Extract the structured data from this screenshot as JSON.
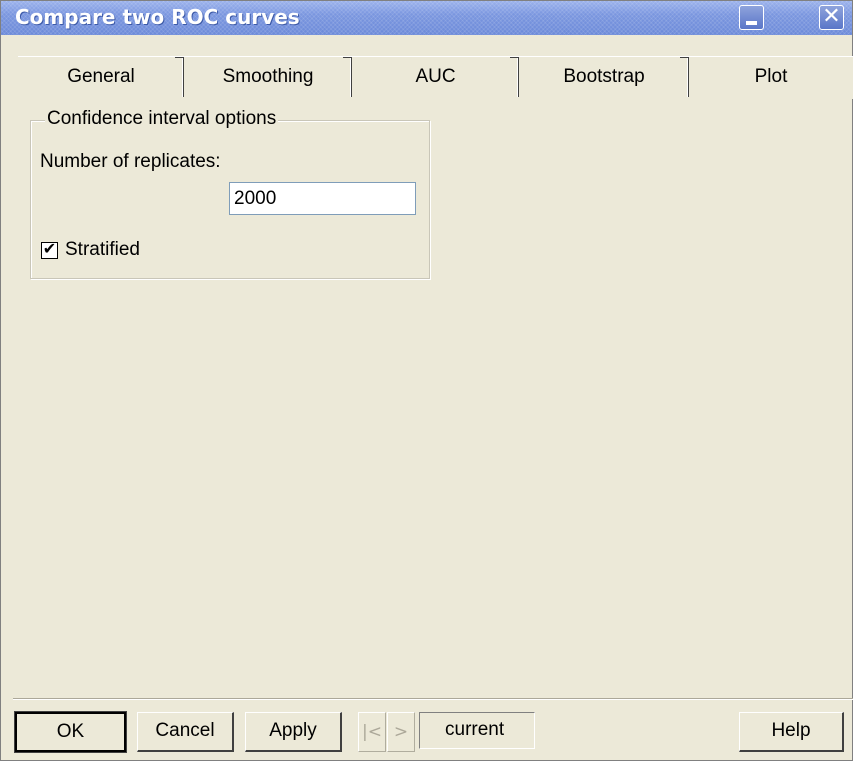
{
  "window": {
    "title": "Compare two ROC curves",
    "minimize_icon": "minimize-icon",
    "close_icon": "close-icon",
    "close_glyph": "✕"
  },
  "tabs": [
    {
      "label": "General"
    },
    {
      "label": "Smoothing"
    },
    {
      "label": "AUC"
    },
    {
      "label": "Bootstrap"
    },
    {
      "label": "Plot"
    }
  ],
  "confidence_group": {
    "legend": "Confidence interval options",
    "replicates_label": "Number of replicates:",
    "replicates_value": "2000",
    "stratified_label": "Stratified",
    "stratified_checked": true,
    "check_glyph": "✔"
  },
  "footer": {
    "ok_label": "OK",
    "cancel_label": "Cancel",
    "apply_label": "Apply",
    "prev_glyph": "|<",
    "next_glyph": ">",
    "current_label": "current",
    "help_label": "Help"
  }
}
